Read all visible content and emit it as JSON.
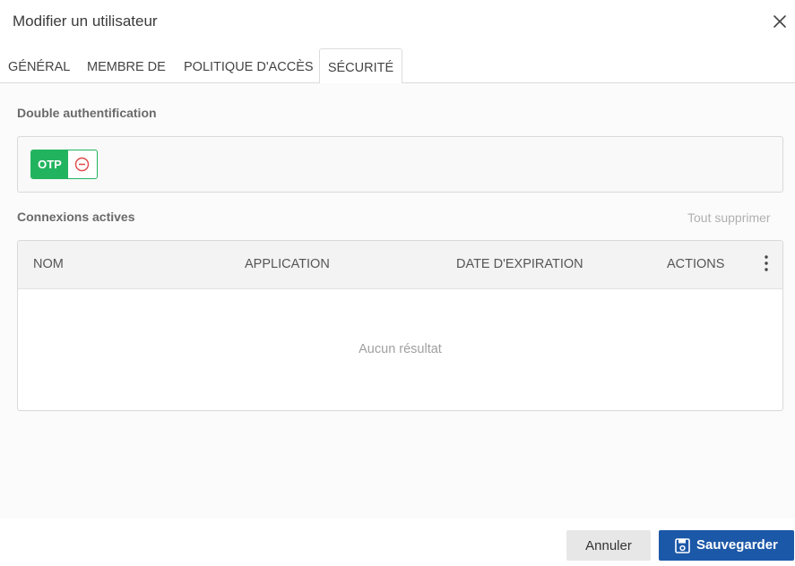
{
  "dialog": {
    "title": "Modifier un utilisateur"
  },
  "tabs": [
    {
      "label": "GÉNÉRAL"
    },
    {
      "label": "MEMBRE DE"
    },
    {
      "label": "POLITIQUE D'ACCÈS"
    },
    {
      "label": "SÉCURITÉ",
      "active": true
    }
  ],
  "security": {
    "two_factor_label": "Double authentification",
    "otp_label": "OTP",
    "active_sessions_label": "Connexions actives",
    "delete_all_label": "Tout supprimer"
  },
  "table": {
    "columns": [
      "NOM",
      "APPLICATION",
      "DATE D'EXPIRATION",
      "ACTIONS"
    ],
    "rows": [],
    "empty_text": "Aucun résultat"
  },
  "footer": {
    "cancel_label": "Annuler",
    "save_label": "Sauvegarder"
  },
  "colors": {
    "accent_green": "#22b35e",
    "primary_blue": "#1c58a8",
    "danger_red": "#e04848"
  },
  "icons": {
    "close": "close-icon",
    "remove": "minus-circle-icon",
    "menu": "kebab-menu-icon",
    "save": "floppy-disk-icon"
  }
}
